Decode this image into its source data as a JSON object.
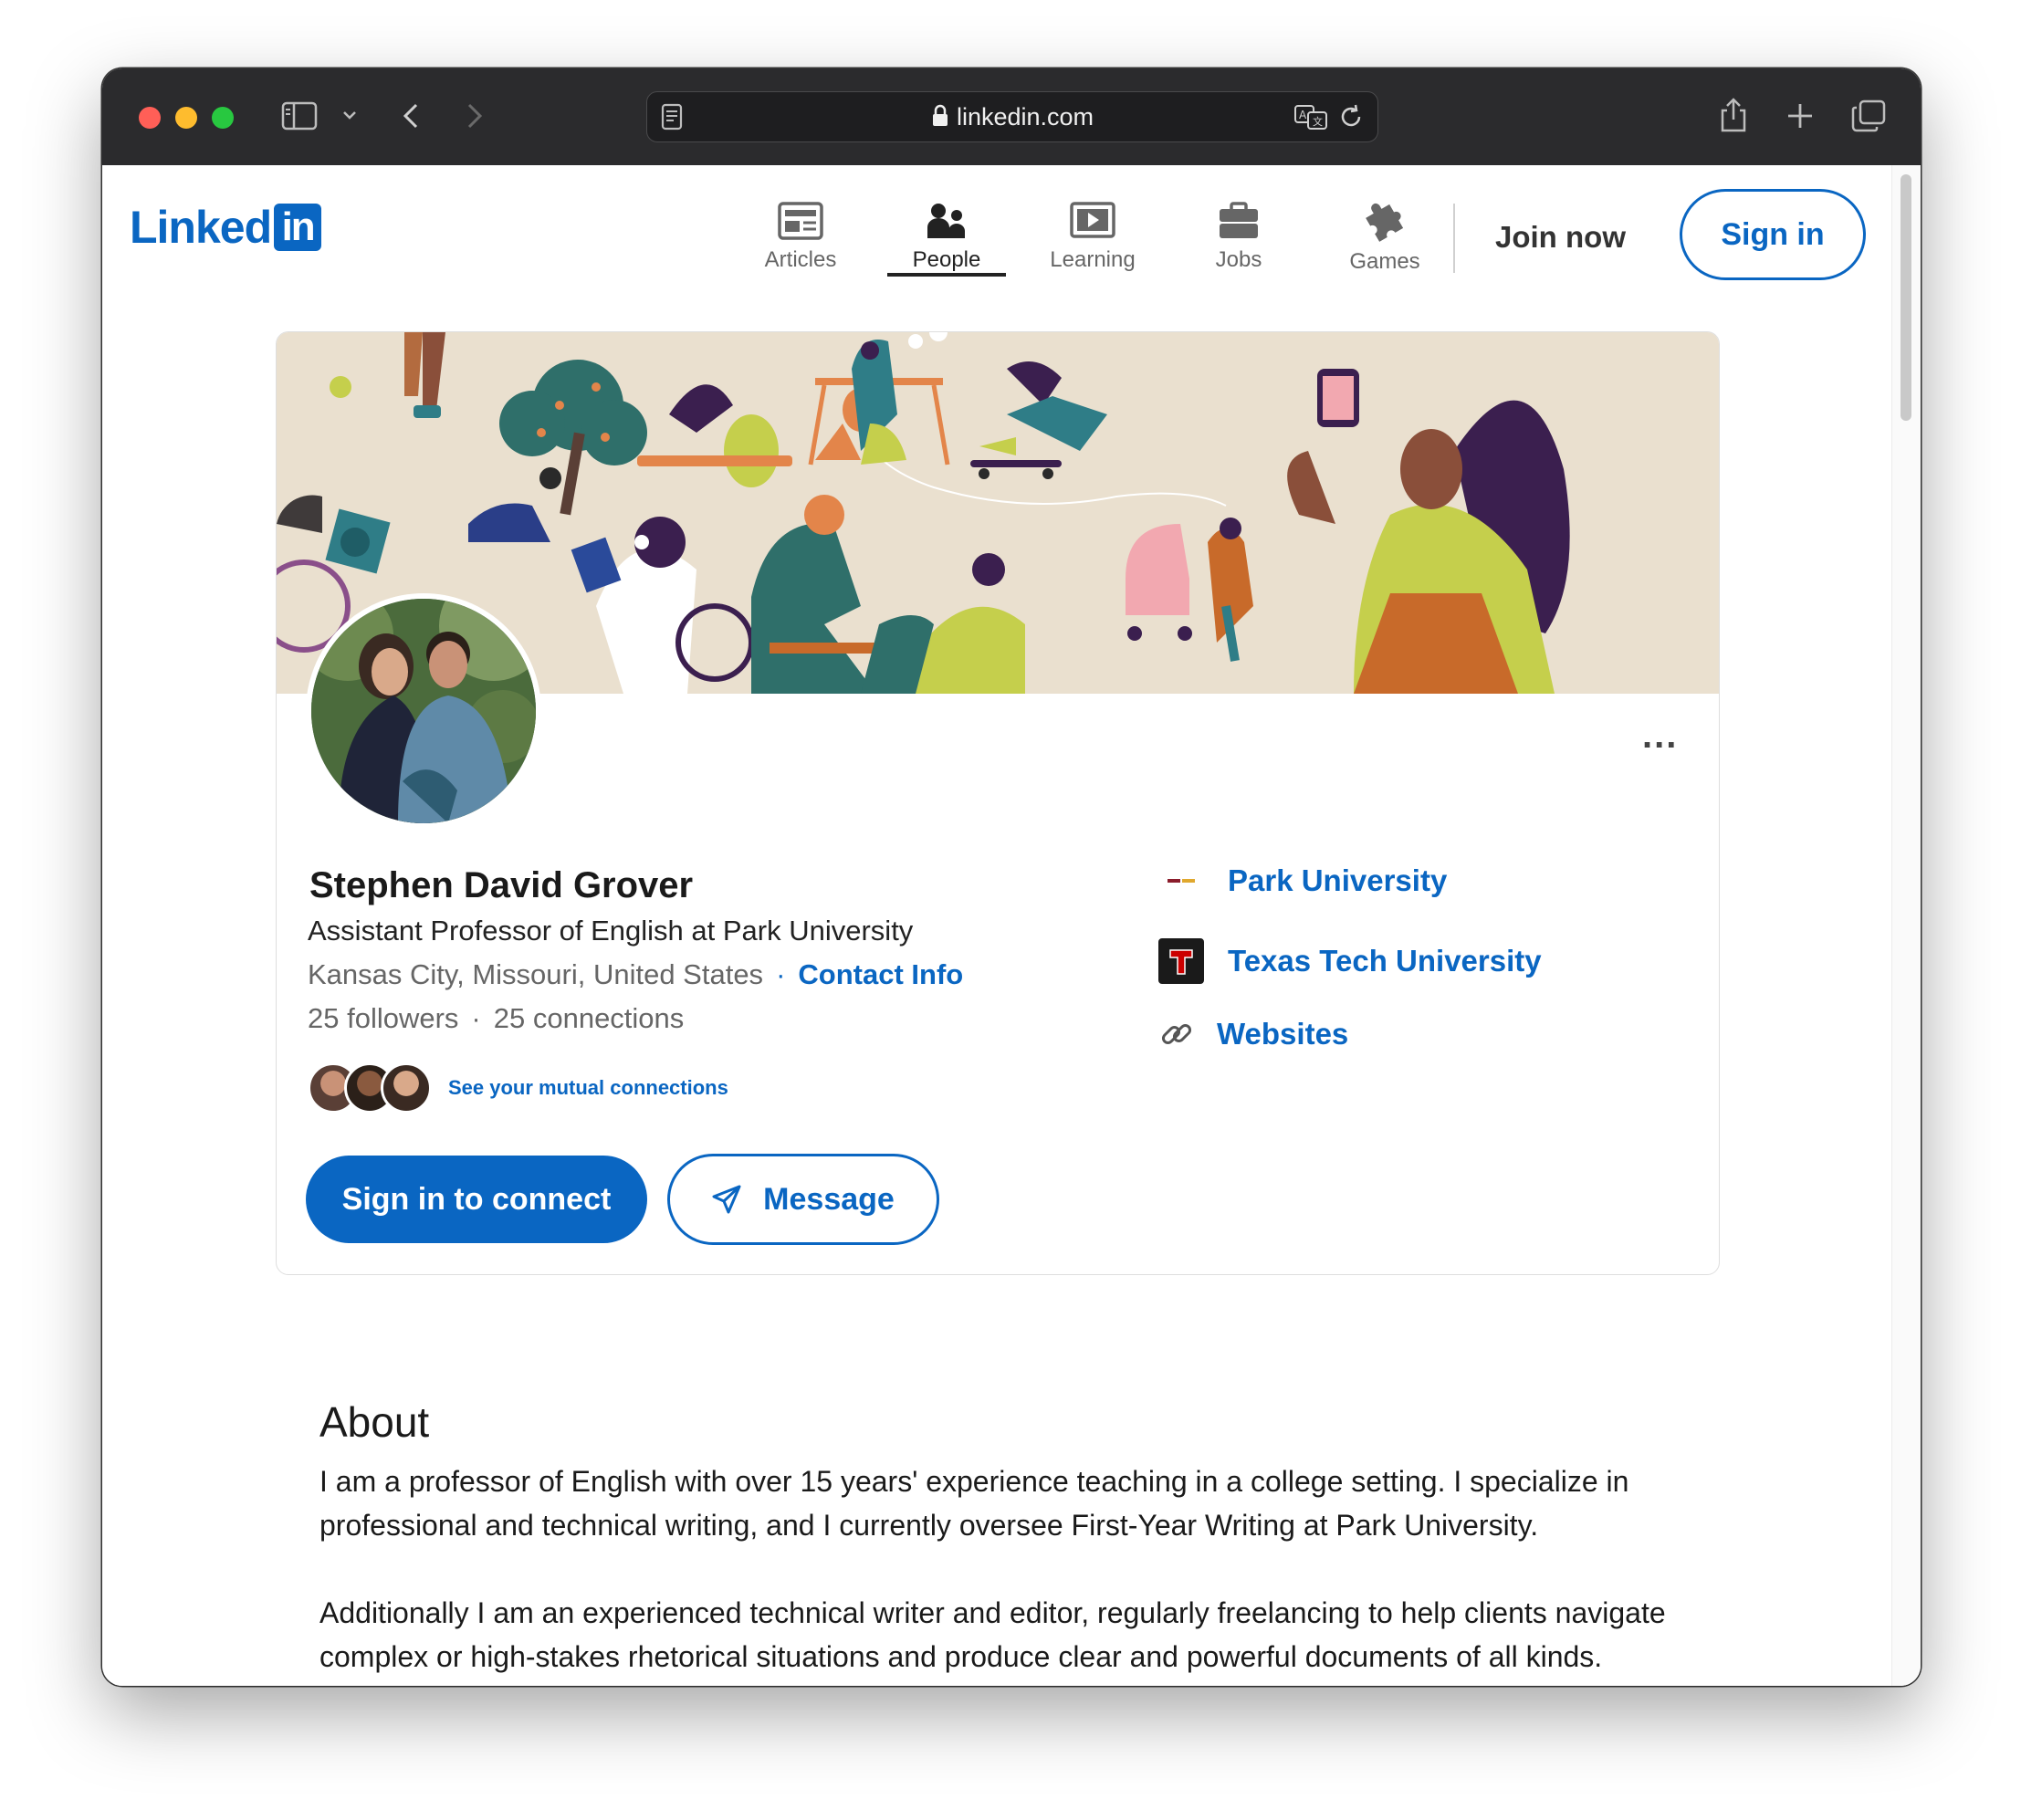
{
  "browser": {
    "url": "linkedin.com"
  },
  "header": {
    "logo_word": "Linked",
    "logo_box": "in",
    "nav": [
      {
        "label": "Articles",
        "icon": "articles-icon"
      },
      {
        "label": "People",
        "icon": "people-icon",
        "active": true
      },
      {
        "label": "Learning",
        "icon": "learning-icon"
      },
      {
        "label": "Jobs",
        "icon": "jobs-icon"
      },
      {
        "label": "Games",
        "icon": "games-icon"
      }
    ],
    "join_now": "Join now",
    "sign_in": "Sign in"
  },
  "profile": {
    "more": "...",
    "name": "Stephen David Grover",
    "headline": "Assistant Professor of English at Park University",
    "location": "Kansas City, Missouri, United States",
    "contact_info": "Contact Info",
    "followers": "25 followers",
    "connections": "25 connections",
    "mutual": "See your mutual connections",
    "connect_button": "Sign in to connect",
    "message_button": "Message",
    "side_links": [
      {
        "label": "Park University",
        "icon": "park-university-logo"
      },
      {
        "label": "Texas Tech University",
        "icon": "texas-tech-logo"
      },
      {
        "label": "Websites",
        "icon": "link-icon"
      }
    ]
  },
  "about": {
    "title": "About",
    "paragraph1": "I am a professor of English with over 15 years' experience teaching in a college setting. I specialize in professional and technical writing, and I currently oversee First-Year Writing at Park University.",
    "paragraph2": "Additionally I am an experienced technical writer and editor, regularly freelancing to help clients navigate complex or high-stakes rhetorical situations and produce clear and powerful documents of all kinds."
  },
  "colors": {
    "brand": "#0a66c2",
    "banner_bg": "#eae0cf"
  }
}
